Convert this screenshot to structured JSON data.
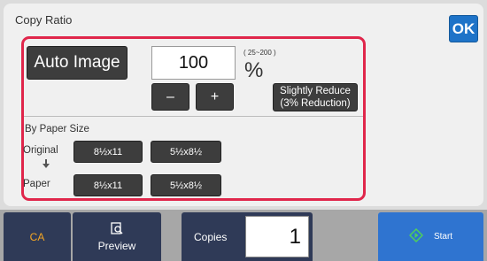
{
  "panel": {
    "title": "Copy Ratio",
    "ok_label": "OK"
  },
  "ratio": {
    "auto_image_label": "Auto Image",
    "value": "100",
    "range_note": "( 25~200 )",
    "unit": "%",
    "minus_label": "–",
    "plus_label": "+",
    "slight_reduce_line1": "Slightly Reduce",
    "slight_reduce_line2": "(3% Reduction)"
  },
  "paper_size": {
    "title": "By Paper Size",
    "original_label": "Original",
    "paper_label": "Paper",
    "original_sizes": [
      "8½x11",
      "5½x8½"
    ],
    "paper_sizes": [
      "8½x11",
      "5½x8½"
    ]
  },
  "bottom_bar": {
    "ca_label": "CA",
    "preview_label": "Preview",
    "copies_label": "Copies",
    "copies_value": "1",
    "start_label": "Start"
  },
  "colors": {
    "accent": "#1e73c8",
    "highlight_frame": "#e0264b",
    "ca_text": "#f5a623",
    "start_bg": "#2f74d0"
  },
  "icons": {
    "preview": "preview-icon",
    "start": "start-icon",
    "arrow": "arrow-down-icon"
  }
}
